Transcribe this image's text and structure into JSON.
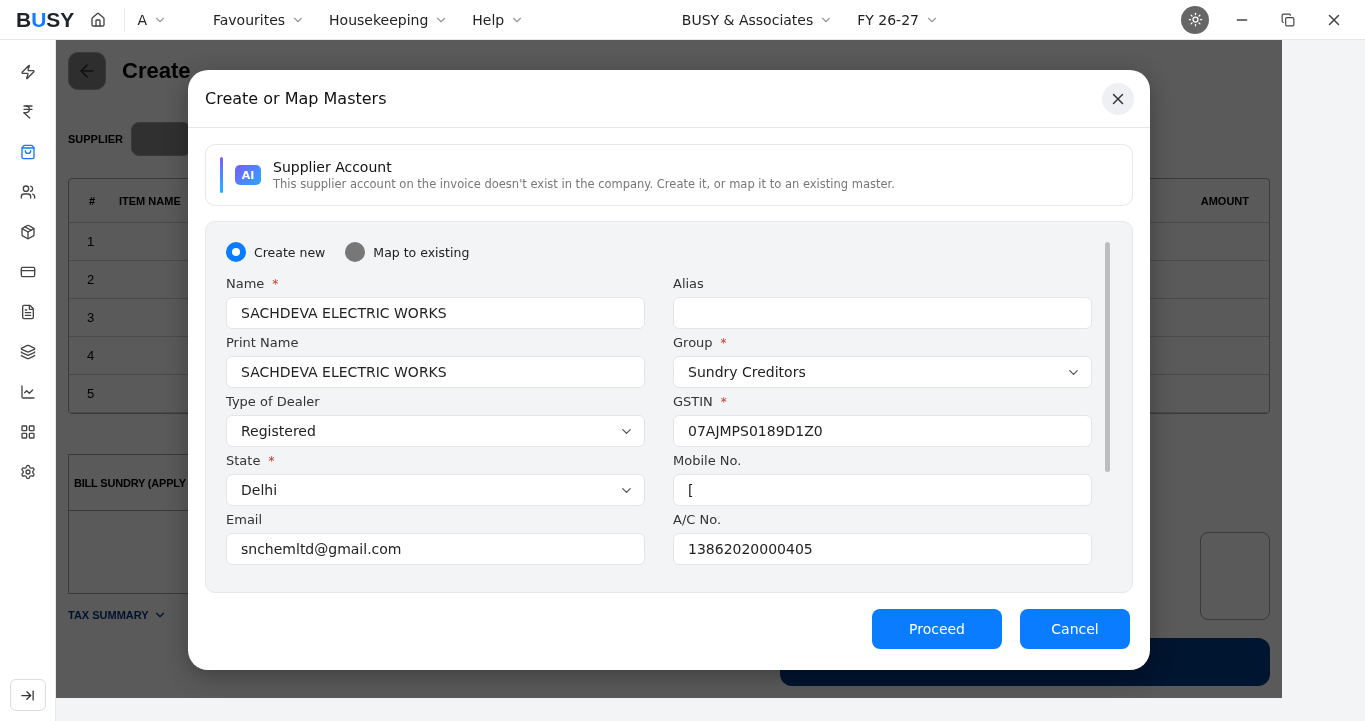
{
  "topbar": {
    "logo": "BUSY",
    "user": "A",
    "menus": [
      "Favourites",
      "Housekeeping",
      "Help"
    ],
    "company": "BUSY & Associates",
    "year": "FY 26-27"
  },
  "sidebar": {
    "items": [
      {
        "selected": false
      },
      {
        "selected": false
      },
      {
        "selected": true
      },
      {
        "selected": false
      },
      {
        "selected": false
      },
      {
        "selected": false
      },
      {
        "selected": false
      },
      {
        "selected": false
      },
      {
        "selected": false
      },
      {
        "selected": false
      },
      {
        "selected": false
      }
    ]
  },
  "page": {
    "title": "Create",
    "supplier_label": "SUPPLIER",
    "table": {
      "columns": [
        "#",
        "ITEM NAME",
        "AMOUNT"
      ],
      "rows": [
        "1",
        "2",
        "3",
        "4",
        "5"
      ]
    },
    "bill_sundry": "BILL SUNDRY (APPLY",
    "tax_summary": "TAX SUMMARY"
  },
  "dialog": {
    "title": "Create or Map Masters",
    "info": {
      "badge": "AI",
      "title": "Supplier Account",
      "text": "This supplier account on the invoice doesn't exist in the company. Create it, or map it to an existing master."
    },
    "options": [
      {
        "label": "Create new",
        "selected": true
      },
      {
        "label": "Map to existing",
        "selected": false
      }
    ],
    "fields": [
      {
        "label": "Name",
        "kind": "text",
        "required_mark": "*",
        "value": "SACHDEVA ELECTRIC WORKS"
      },
      {
        "label": "Alias",
        "kind": "text"
      },
      {
        "label": "Print Name",
        "kind": "text",
        "value": "SACHDEVA ELECTRIC WORKS"
      },
      {
        "label": "Group",
        "kind": "select",
        "required_mark": "*",
        "value": "Sundry Creditors"
      },
      {
        "label": "Type of Dealer",
        "kind": "select",
        "value": "Registered"
      },
      {
        "label": "GSTIN",
        "kind": "text",
        "required_mark": "*",
        "value": "07AJMPS0189D1Z0"
      },
      {
        "label": "State",
        "kind": "select",
        "required_mark": "*",
        "value": "Delhi"
      },
      {
        "label": "Mobile No.",
        "kind": "text",
        "value": "["
      },
      {
        "label": "Email",
        "kind": "text",
        "value": "snchemltd@gmail.com"
      },
      {
        "label": "A/C No.",
        "kind": "text",
        "value": "13862020000405"
      }
    ],
    "buttons": [
      {
        "label": "Proceed"
      },
      {
        "label": "Cancel"
      }
    ]
  }
}
